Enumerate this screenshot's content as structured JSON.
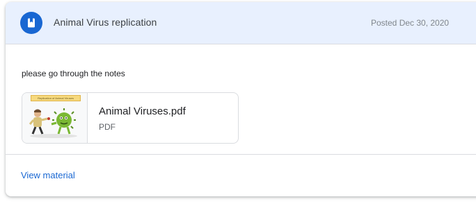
{
  "post": {
    "title": "Animal Virus replication",
    "posted": "Posted Dec 30, 2020",
    "icon": "material-book-icon",
    "accent_color": "#1967d2",
    "header_bg": "#e8f0fe"
  },
  "body": {
    "instructions": "please go through the notes"
  },
  "attachment": {
    "file_name": "Animal Viruses.pdf",
    "file_type": "PDF",
    "thumbnail_title": "Replication of Animal Viruses"
  },
  "footer": {
    "view_link": "View material"
  }
}
